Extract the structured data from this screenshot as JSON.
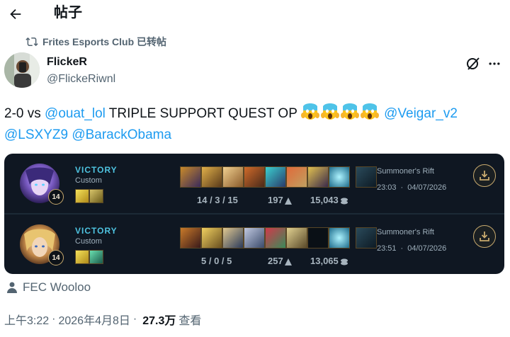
{
  "header": {
    "title": "帖子"
  },
  "retweet": {
    "text": "Frites Esports Club 已转帖"
  },
  "author": {
    "name": "FlickeR",
    "handle": "@FlickeRiwnl"
  },
  "tweet": {
    "text_prefix": "2-0 vs ",
    "mention1": "@ouat_lol",
    "text_middle": " TRIPLE SUPPORT QUEST OP ",
    "emojis": [
      "screaming-face",
      "screaming-face",
      "screaming-face",
      "screaming-face"
    ],
    "mention2": "@Veigar_v2",
    "mention3": "@LSXYZ9",
    "mention4": "@BarackObama"
  },
  "matches": [
    {
      "result": "VICTORY",
      "queue": "Custom",
      "level": "14",
      "kda": "14 / 3 / 15",
      "cs": "197",
      "gold": "15,043",
      "map": "Summoner's Rift",
      "duration": "23:03",
      "date": "04/07/2026"
    },
    {
      "result": "VICTORY",
      "queue": "Custom",
      "level": "14",
      "kda": "5 / 0 / 5",
      "cs": "257",
      "gold": "13,065",
      "map": "Summoner's Rift",
      "duration": "23:51",
      "date": "04/07/2026"
    }
  ],
  "location": {
    "text": "FEC Wooloo"
  },
  "meta": {
    "time": "上午3:22",
    "date": "2026年4月8日",
    "views_count": "27.3万",
    "views_label": "查看"
  },
  "colors": {
    "accent": "#1d9bf0",
    "card_bg": "#0f1722",
    "victory": "#4ec3e0",
    "gold_border": "#c8aa6e"
  }
}
